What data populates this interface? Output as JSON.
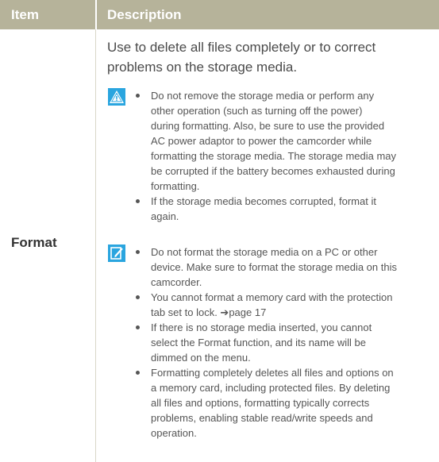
{
  "header": {
    "item_label": "Item",
    "description_label": "Description"
  },
  "row": {
    "label": "Format",
    "intro_lines": [
      "Use to delete all files completely or to correct",
      "problems on the storage media."
    ],
    "warning": {
      "icon": "warning-triangle-icon",
      "bullets": [
        [
          "Do not remove the storage media or perform any",
          "other operation (such as turning off the power)",
          "during formatting. Also, be sure to use the provided",
          "AC power adaptor to power the camcorder while",
          "formatting the storage media. The storage media may",
          "be corrupted if the battery becomes exhausted during",
          "formatting."
        ],
        [
          "If the storage media becomes corrupted, format it",
          "again."
        ]
      ]
    },
    "note": {
      "icon": "memo-pencil-icon",
      "bullets": [
        [
          "Do not format the storage media on a PC or other",
          "device. Make sure to format the storage media on this",
          "camcorder."
        ],
        [
          "You cannot format a memory card with the protection",
          "tab set to lock. ➔page 17"
        ],
        [
          "If there is no storage media inserted, you cannot",
          "select the Format function, and its name will be",
          "dimmed on the menu."
        ],
        [
          "Formatting completely deletes all files and options on",
          "a memory card, including protected files. By deleting",
          "all files and options, formatting typically corrects",
          "problems, enabling stable read/write speeds and",
          "operation."
        ]
      ]
    }
  }
}
